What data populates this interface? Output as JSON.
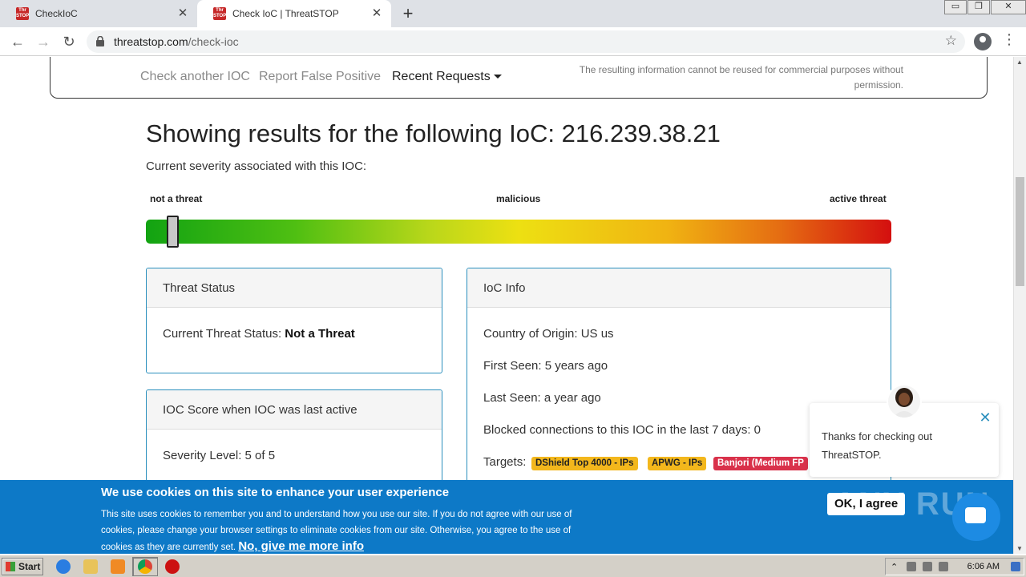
{
  "browser": {
    "tabs": [
      {
        "title": "CheckIoC"
      },
      {
        "title": "Check IoC | ThreatSTOP"
      }
    ],
    "favicon_text": "Threat STOP",
    "new_tab_symbol": "+",
    "url_host": "threatstop.com",
    "url_path": "/check-ioc",
    "window_controls": {
      "minimize": "▭",
      "restore": "❐",
      "close": "✕"
    }
  },
  "nav": {
    "check_another": "Check another IOC",
    "report_false_positive": "Report False Positive",
    "recent_requests": "Recent Requests",
    "disclaimer": "The resulting information cannot be reused for commercial purposes without permission."
  },
  "result": {
    "heading": "Showing results for the following IoC: 216.239.38.21",
    "severity_caption": "Current severity associated with this IOC:",
    "scale_labels": {
      "low": "not a threat",
      "mid": "malicious",
      "high": "active threat"
    },
    "severity_position_fraction": 0.02
  },
  "threat_status": {
    "title": "Threat Status",
    "label": "Current Threat Status:",
    "value": "Not a Threat"
  },
  "ioc_score": {
    "title": "IOC Score when IOC was last active",
    "severity_line": "Severity Level: 5 of 5"
  },
  "ioc_info": {
    "title": "IoC Info",
    "country": "Country of Origin: US us",
    "first_seen": "First Seen: 5 years ago",
    "last_seen": "Last Seen: a year ago",
    "blocked": "Blocked connections to this IOC in the last 7 days: 0",
    "targets_label": "Targets:",
    "targets": [
      {
        "label": "DShield Top 4000 - IPs",
        "color": "#f3b71c"
      },
      {
        "label": "APWG - IPs",
        "color": "#f3b71c"
      },
      {
        "label": "Banjori (Medium FP",
        "color": "#d9314a"
      }
    ]
  },
  "chat": {
    "message": "Thanks for checking out ThreatSTOP.",
    "close": "✕"
  },
  "cookie": {
    "title": "We use cookies on this site to enhance your user experience",
    "text": "This site uses cookies to remember you and to understand how you use our site. If you do not agree with our use of cookies, please change your browser settings to eliminate cookies from our site. Otherwise, you agree to the use of cookies as they are currently set.",
    "link": "No, give me more info",
    "agree": "OK, I agree",
    "watermark": "ANY RUN"
  },
  "taskbar": {
    "start": "Start",
    "clock": "6:06 AM"
  },
  "colors": {
    "accent_blue": "#0d79c7",
    "card_border": "#2a8fbd",
    "tag_yellow": "#f3b71c",
    "tag_red": "#d9314a"
  }
}
